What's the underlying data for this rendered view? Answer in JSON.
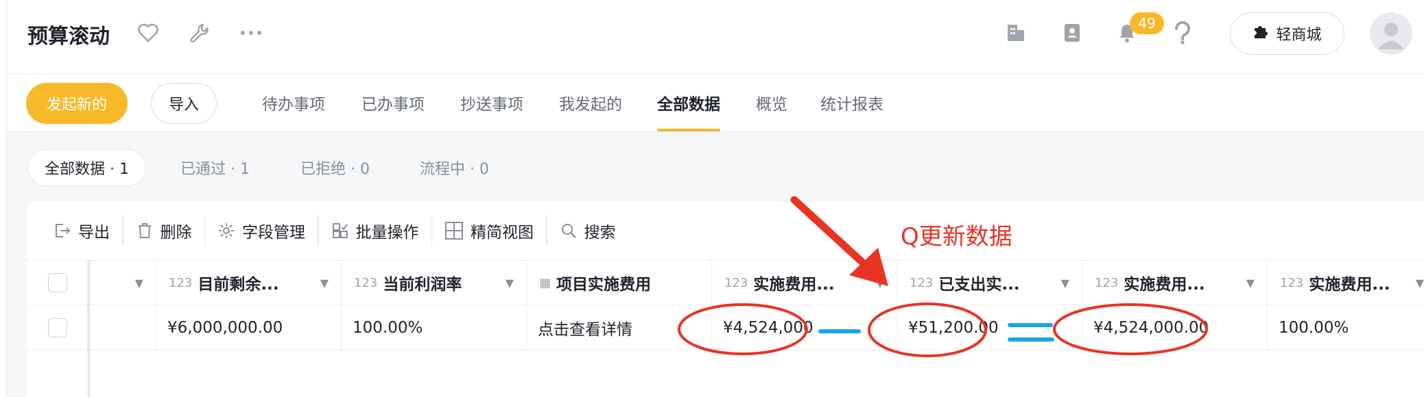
{
  "header": {
    "title": "预算滚动",
    "notification_count": "49",
    "mall_label": "轻商城"
  },
  "actions": {
    "new_label": "发起新的",
    "import_label": "导入"
  },
  "tabs": [
    {
      "label": "待办事项"
    },
    {
      "label": "已办事项"
    },
    {
      "label": "抄送事项"
    },
    {
      "label": "我发起的"
    },
    {
      "label": "全部数据",
      "active": true
    },
    {
      "label": "概览"
    },
    {
      "label": "统计报表"
    }
  ],
  "filters": [
    {
      "label": "全部数据 · 1",
      "active": true
    },
    {
      "label": "已通过 · 1"
    },
    {
      "label": "已拒绝 · 0"
    },
    {
      "label": "流程中 · 0"
    }
  ],
  "toolbar": {
    "export_label": "导出",
    "delete_label": "删除",
    "fields_label": "字段管理",
    "batch_label": "批量操作",
    "compact_label": "精简视图",
    "search_label": "搜索"
  },
  "table": {
    "columns": [
      {
        "label": "目前剩余...",
        "type_icon": "number-icon",
        "has_caret": true
      },
      {
        "label": "当前利润率",
        "type_icon": "number-icon",
        "has_caret": true
      },
      {
        "label": "项目实施费用",
        "type_icon": "table-icon",
        "has_caret": false
      },
      {
        "label": "实施费用...",
        "type_icon": "number-icon",
        "has_caret": true
      },
      {
        "label": "已支出实...",
        "type_icon": "number-icon",
        "has_caret": true
      },
      {
        "label": "实施费用...",
        "type_icon": "number-icon",
        "has_caret": true
      },
      {
        "label": "实施费用...",
        "type_icon": "number-icon",
        "has_caret": true
      }
    ],
    "rows": [
      {
        "cells": [
          "¥6,000,000.00",
          "100.00%",
          "点击查看详情",
          "¥4,524,000",
          "¥51,200.00",
          "¥4,524,000.00",
          "100.00%"
        ]
      }
    ]
  },
  "annotation": {
    "text": "Q更新数据",
    "color": "#ea3323",
    "equation_color": "#1aa6e8"
  },
  "colors": {
    "accent": "#f7b928",
    "annotation_red": "#ea3323",
    "annotation_blue": "#1aa6e8"
  }
}
